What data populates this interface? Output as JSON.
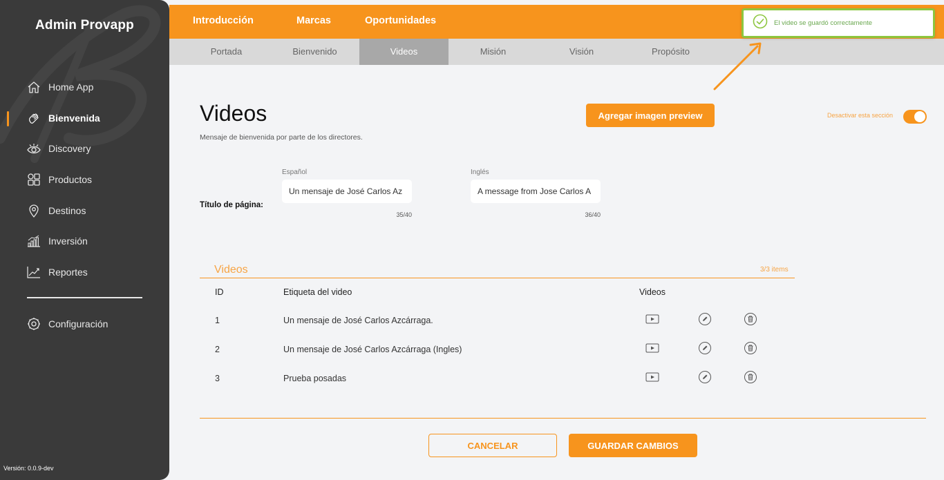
{
  "sidebar": {
    "app_title": "Admin Provapp",
    "items": [
      {
        "label": "Home App",
        "icon": "home-icon"
      },
      {
        "label": "Bienvenida",
        "icon": "wave-hand-icon",
        "active": true
      },
      {
        "label": "Discovery",
        "icon": "eye-icon"
      },
      {
        "label": "Productos",
        "icon": "grid-icon"
      },
      {
        "label": "Destinos",
        "icon": "location-pin-icon"
      },
      {
        "label": "Inversión",
        "icon": "bar-chart-icon"
      },
      {
        "label": "Reportes",
        "icon": "line-chart-icon"
      }
    ],
    "config": {
      "label": "Configuración",
      "icon": "gear-icon"
    },
    "version": "Versión: 0.0.9-dev"
  },
  "topnav": {
    "tabs": [
      "Introducción",
      "Marcas",
      "Oportunidades"
    ]
  },
  "subnav": {
    "tabs": [
      "Portada",
      "Bienvenido",
      "Videos",
      "Misión",
      "Visión",
      "Propósito"
    ],
    "active": "Videos"
  },
  "toast": {
    "message": "El video se guardó correctamente",
    "color": "#8dc63f"
  },
  "main": {
    "title": "Videos",
    "description": "Mensaje de bienvenida por parte de los directores.",
    "preview_button": "Agregar imagen preview",
    "toggle_label": "Desactivar esta sección",
    "page_title_label": "Título de página:",
    "fields": [
      {
        "lang": "Español",
        "value": "Un mensaje de José Carlos Az",
        "counter": "35/40"
      },
      {
        "lang": "Inglés",
        "value": "A message from Jose Carlos A",
        "counter": "36/40"
      }
    ]
  },
  "videos": {
    "section_title": "Videos",
    "count": "3/3 items",
    "headers": {
      "id": "ID",
      "label": "Etiqueta del video",
      "videos": "Videos"
    },
    "rows": [
      {
        "id": "1",
        "label": "Un mensaje de José Carlos Azcárraga."
      },
      {
        "id": "2",
        "label": "Un mensaje de José Carlos Azcárraga (Ingles)"
      },
      {
        "id": "3",
        "label": "Prueba posadas"
      }
    ]
  },
  "actions": {
    "cancel": "CANCELAR",
    "save": "GUARDAR CAMBIOS"
  },
  "colors": {
    "accent": "#f7941d",
    "sidebar": "#3a3a3a",
    "success": "#8dc63f"
  }
}
